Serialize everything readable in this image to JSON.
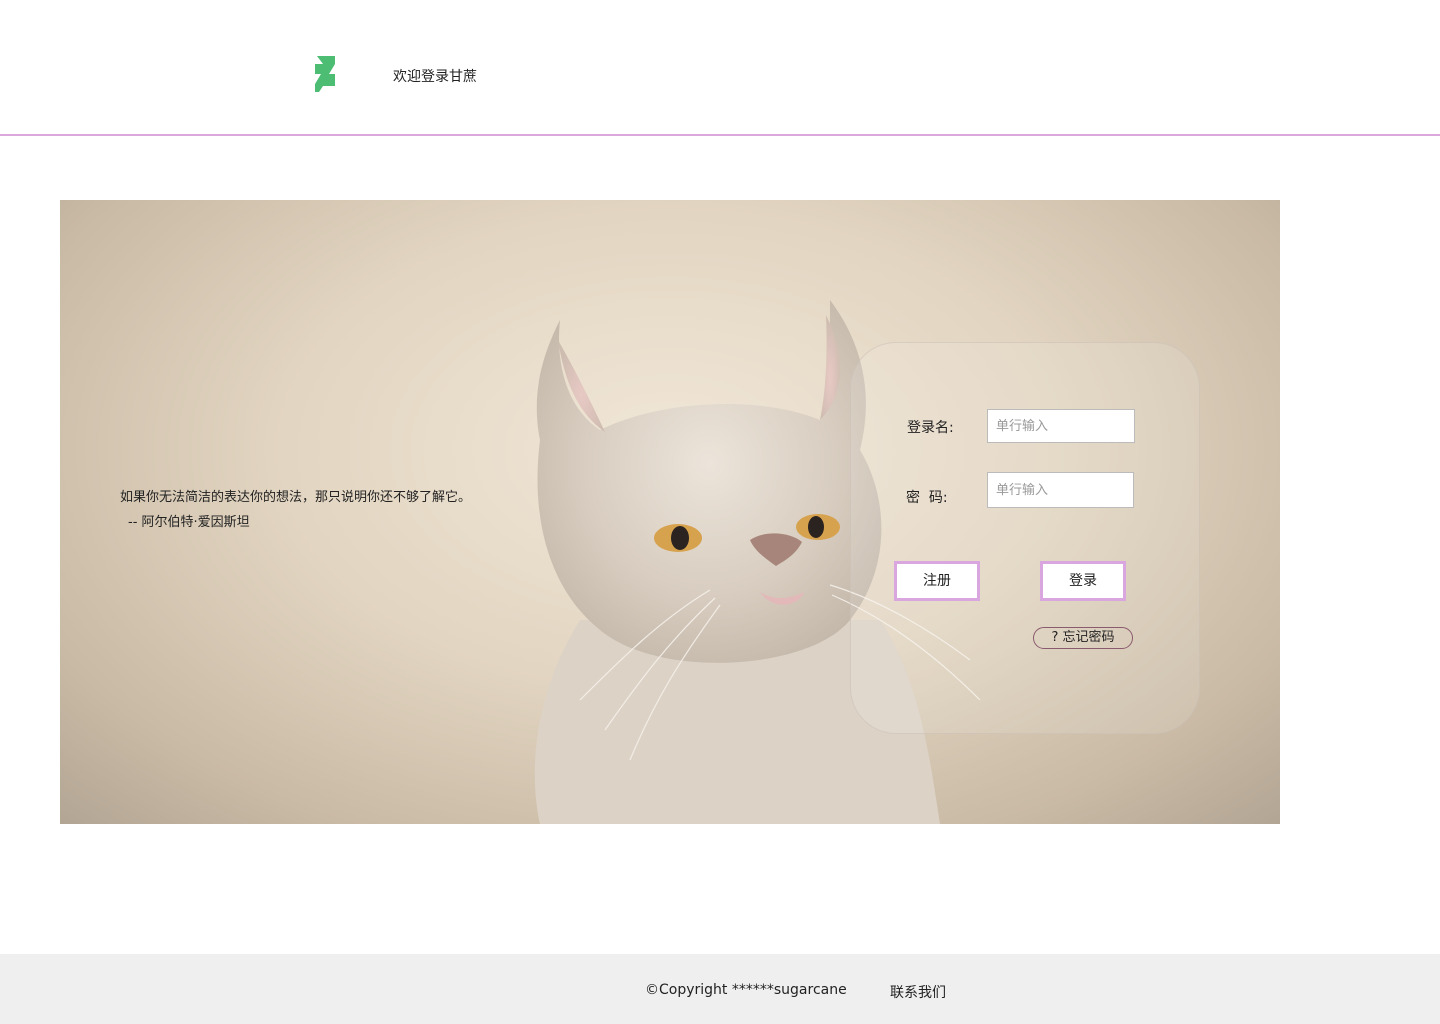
{
  "header": {
    "logo_icon": "deviantart-logo-icon",
    "logo_color": "#4dbd74",
    "welcome_text": "欢迎登录甘蔗",
    "divider_color": "#dba7dd"
  },
  "banner": {
    "quote_text": "如果你无法简洁的表达你的想法，那只说明你还不够了解它。",
    "quote_author": "-- 阿尔伯特·爱因斯坦"
  },
  "login": {
    "username_label": "登录名:",
    "username_placeholder": "单行输入",
    "password_label": "密  码:",
    "password_placeholder": "单行输入",
    "register_label": "注册",
    "login_label": "登录",
    "forgot_label": "? 忘记密码",
    "button_border_color": "#d9a6e0"
  },
  "footer": {
    "copyright": "©Copyright ******sugarcane",
    "contact": "联系我们"
  }
}
